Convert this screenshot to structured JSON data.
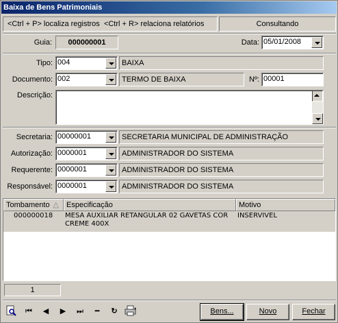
{
  "window": {
    "title": "Baixa de Bens Patrimoniais"
  },
  "statusbar": {
    "hint_locate": "<Ctrl + P> localiza registros",
    "hint_reports": "<Ctrl + R> relaciona relatórios",
    "mode": "Consultando"
  },
  "form": {
    "guia_label": "Guia:",
    "guia_value": "000000001",
    "data_label": "Data:",
    "data_value": "05/01/2008",
    "tipo_label": "Tipo:",
    "tipo_code": "004",
    "tipo_desc": "BAIXA",
    "documento_label": "Documento:",
    "documento_code": "002",
    "documento_desc": "TERMO DE BAIXA",
    "numero_label": "Nº:",
    "numero_value": "00001",
    "descricao_label": "Descrição:",
    "descricao_value": "",
    "secretaria_label": "Secretaria:",
    "secretaria_code": "00000001",
    "secretaria_desc": "SECRETARIA MUNICIPAL DE ADMINISTRAÇÃO",
    "autorizacao_label": "Autorização:",
    "autorizacao_code": "0000001",
    "autorizacao_desc": "ADMINISTRADOR DO SISTEMA",
    "requerente_label": "Requerente:",
    "requerente_code": "0000001",
    "requerente_desc": "ADMINISTRADOR DO SISTEMA",
    "responsavel_label": "Responsável:",
    "responsavel_code": "0000001",
    "responsavel_desc": "ADMINISTRADOR DO SISTEMA"
  },
  "grid": {
    "columns": [
      "Tombamento",
      "Especificação",
      "Motivo"
    ],
    "sort_indicator": "△",
    "rows": [
      {
        "tombamento": "000000018",
        "especificacao": "MESA AUXILIAR RETANGULAR 02 GAVETAS COR CREME 400X",
        "motivo": "INSERVIVEL"
      }
    ]
  },
  "counter": "1",
  "toolbar": {
    "icons": [
      "search-icon",
      "first-record-icon",
      "previous-record-icon",
      "next-record-icon",
      "last-record-icon",
      "delete-icon",
      "refresh-icon",
      "print-icon"
    ],
    "glyphs": {
      "first": "⏮",
      "prev": "◀",
      "next": "▶",
      "last": "⏭",
      "delete": "━",
      "refresh": "↻"
    }
  },
  "buttons": {
    "bens": "Bens...",
    "novo": "Novo",
    "fechar": "Fechar"
  },
  "colors": {
    "title_start": "#0a246a",
    "title_end": "#a6caf0",
    "face": "#d4d0c8"
  }
}
